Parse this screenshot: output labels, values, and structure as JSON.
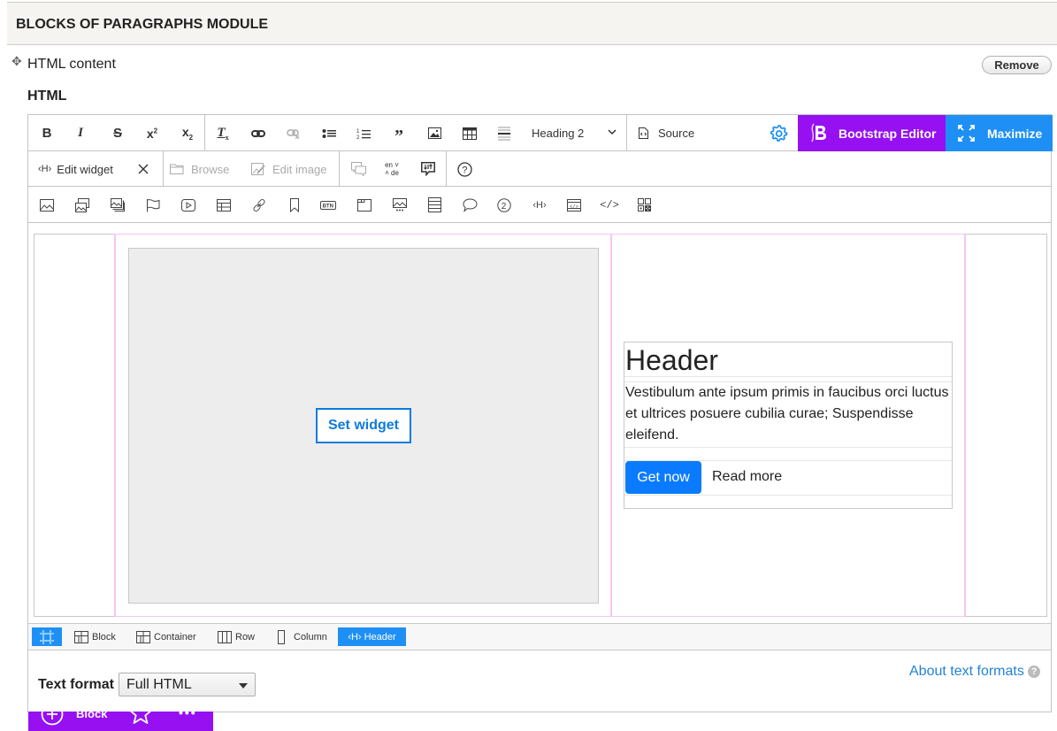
{
  "panel": {
    "title": "Blocks of paragraphs module"
  },
  "paragraph": {
    "label": "HTML content",
    "remove_label": "Remove"
  },
  "field": {
    "label": "HTML"
  },
  "toolbar": {
    "row1": {
      "bold": "bold-icon",
      "italic": "italic-icon",
      "strikethrough": "strikethrough-icon",
      "superscript": "superscript-icon",
      "subscript": "subscript-icon",
      "remove_format": "remove-format-icon",
      "link": "link-icon",
      "unlink": "unlink-icon",
      "bulleted_list": "bulleted-list-icon",
      "numbered_list": "numbered-list-icon",
      "blockquote": "blockquote-icon",
      "image": "image-icon",
      "table": "table-icon",
      "horizontal_line": "horizontal-line-icon",
      "heading_select": "Heading 2",
      "source_label": "Source",
      "bootstrap_editor_label": "Bootstrap Editor",
      "maximize_label": "Maximize"
    },
    "row2": {
      "edit_widget_label": "Edit widget",
      "browse_label": "Browse",
      "edit_image_label": "Edit image",
      "lang_top": "en",
      "lang_bottom": "de"
    },
    "row3_icons": [
      "image",
      "image-gallery",
      "image-stack",
      "flag",
      "video",
      "table",
      "link",
      "bookmark",
      "button",
      "tab",
      "carousel",
      "list-group",
      "speech-bubble",
      "badge-number",
      "header",
      "code-block",
      "code",
      "qr-grid"
    ]
  },
  "canvas": {
    "set_widget_label": "Set widget",
    "header_card": {
      "title": "Header",
      "text": "Vestibulum ante ipsum primis in faucibus orci luctus et ultrices posuere cubilia curae; Suspendisse eleifend.",
      "primary_button": "Get now",
      "secondary_link": "Read more"
    },
    "block_bar": {
      "label": "Block"
    }
  },
  "path_bar": {
    "items": [
      {
        "label": "",
        "icon": "select-all-icon",
        "active": true
      },
      {
        "label": "Block",
        "icon": "block-icon",
        "active": false
      },
      {
        "label": "Container",
        "icon": "container-icon",
        "active": false
      },
      {
        "label": "Row",
        "icon": "row-icon",
        "active": false
      },
      {
        "label": "Column",
        "icon": "column-icon",
        "active": false
      },
      {
        "label": "Header",
        "icon": "header-icon",
        "active": true
      }
    ]
  },
  "format": {
    "label": "Text format",
    "selected": "Full HTML",
    "about_link": "About text formats",
    "help": "?"
  },
  "colors": {
    "bootstrap_purple": "#9610f2",
    "maximize_blue": "#1e90f5",
    "primary_button_blue": "#0a7bff",
    "link_blue": "#2283d4",
    "guide_pink": "#f5c6f5"
  }
}
